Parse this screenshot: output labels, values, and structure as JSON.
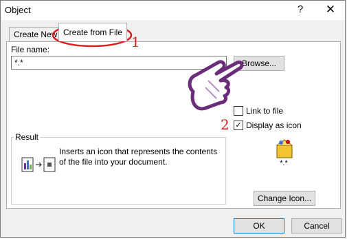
{
  "window": {
    "title": "Object",
    "help_glyph": "?",
    "close_glyph": "✕"
  },
  "tabs": [
    {
      "label": "Create New"
    },
    {
      "label": "Create from File"
    }
  ],
  "filename": {
    "label": "File name:",
    "value": "*.*"
  },
  "browse_label": "Browse...",
  "checkboxes": {
    "link_label": "Link to file",
    "display_label": "Display as icon",
    "display_check": "✓"
  },
  "result": {
    "title": "Result",
    "text": "Inserts an icon that represents the contents of the file into your document."
  },
  "icon_label": "*.*",
  "buttons": {
    "change_icon": "Change Icon...",
    "ok": "OK",
    "cancel": "Cancel"
  },
  "annotations": {
    "step1": "1",
    "step2": "2"
  },
  "colors": {
    "annotation_red": "#d61f1f",
    "hand_purple": "#6b2d7a"
  }
}
